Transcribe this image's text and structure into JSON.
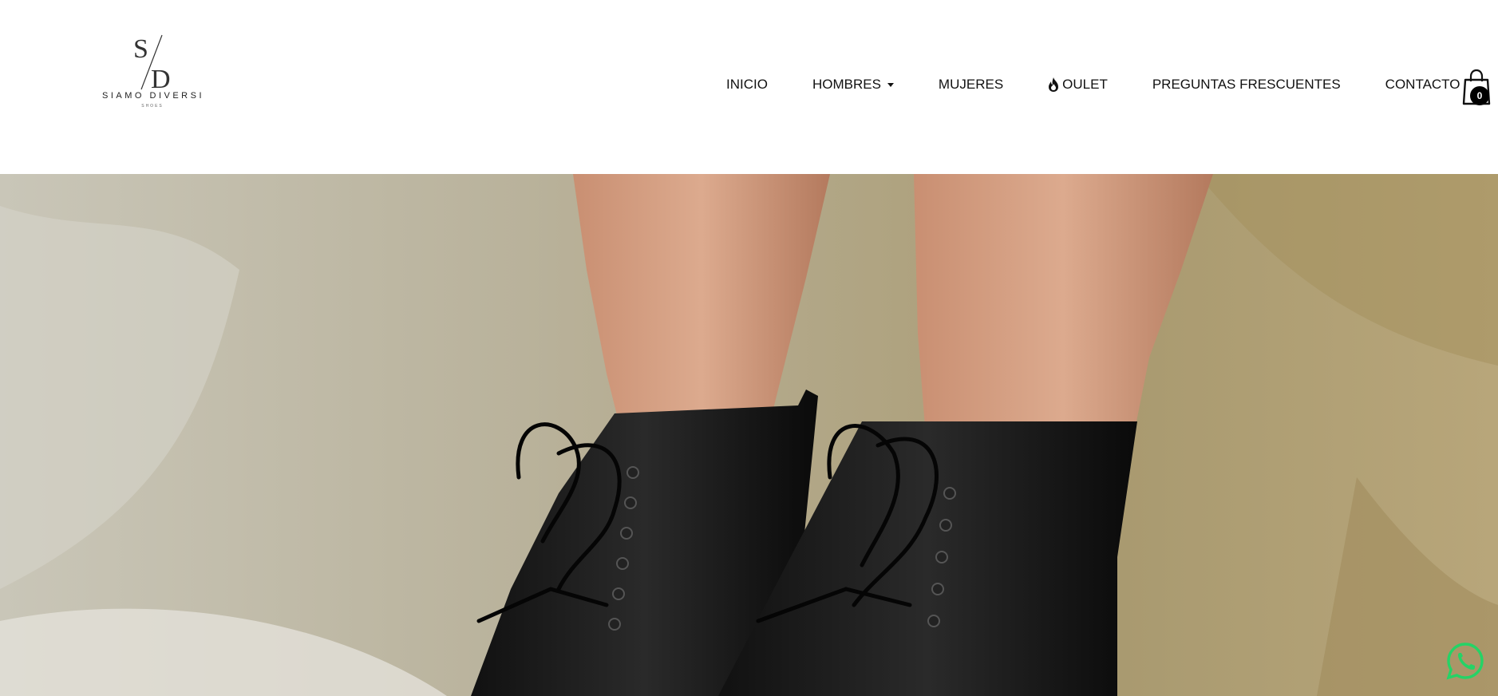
{
  "logo": {
    "monogram": "S/D",
    "brand": "SIAMO DIVERSI",
    "tagline": "SHOES"
  },
  "nav": {
    "items": [
      {
        "label": "INICIO"
      },
      {
        "label": "HOMBRES"
      },
      {
        "label": "MUJERES"
      },
      {
        "label": "OULET"
      },
      {
        "label": "PREGUNTAS FRESCUENTES"
      },
      {
        "label": "CONTACTO"
      }
    ]
  },
  "cart": {
    "count": "0"
  },
  "hero": {
    "alt": "Black leather lace-up ankle boots"
  },
  "whatsapp": {
    "icon": "whatsapp-icon",
    "color": "#25D366"
  }
}
